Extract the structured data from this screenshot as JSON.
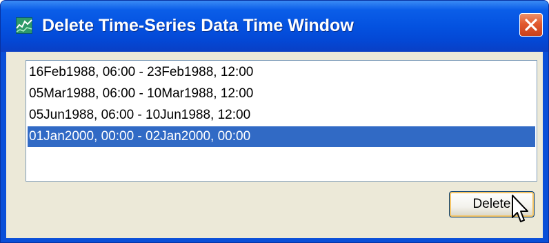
{
  "window": {
    "title": "Delete Time-Series Data Time Window",
    "icon": "chart-icon",
    "titlebar_color": "#0452e0",
    "close_icon": "close-icon"
  },
  "list": {
    "items": [
      {
        "label": "16Feb1988, 06:00 - 23Feb1988, 12:00",
        "selected": false
      },
      {
        "label": "05Mar1988, 06:00 - 10Mar1988, 12:00",
        "selected": false
      },
      {
        "label": "05Jun1988, 06:00 - 10Jun1988, 12:00",
        "selected": false
      },
      {
        "label": "01Jan2000, 00:00 - 02Jan2000, 00:00",
        "selected": true
      }
    ],
    "selection_color": "#316ac5"
  },
  "buttons": {
    "delete_label": "Delete"
  },
  "cursor": {
    "icon": "arrow-cursor-icon"
  }
}
